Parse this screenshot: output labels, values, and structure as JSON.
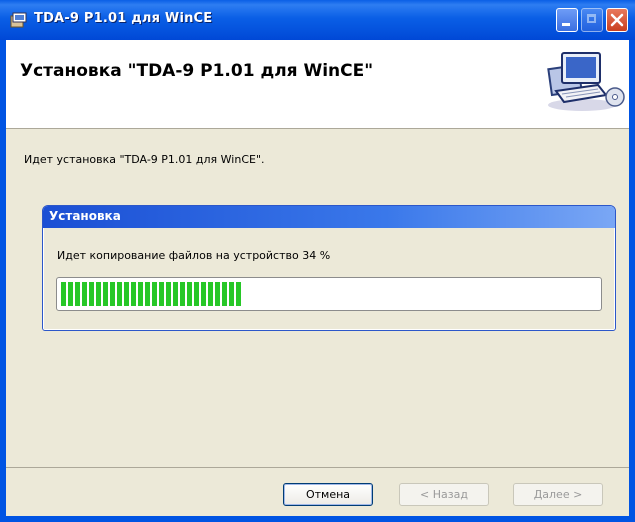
{
  "window": {
    "title": "TDA-9 P1.01 для WinCE"
  },
  "header": {
    "title": "Установка \"TDA-9 P1.01 для WinCE\""
  },
  "status_text": "Идет установка \"TDA-9 P1.01 для WinCE\".",
  "progress_group": {
    "title": "Установка",
    "label": "Идет копирование файлов на устройство 34 %",
    "percent": 34
  },
  "buttons": {
    "cancel": "Отмена",
    "back": "< Назад",
    "next": "Далее >"
  },
  "icons": {
    "app": "installer-icon",
    "header_art": "computer-setup-icon"
  },
  "colors": {
    "titlebar": "#0a5fe6",
    "progress": "#27c727",
    "group_header": "#1b4fd4"
  }
}
